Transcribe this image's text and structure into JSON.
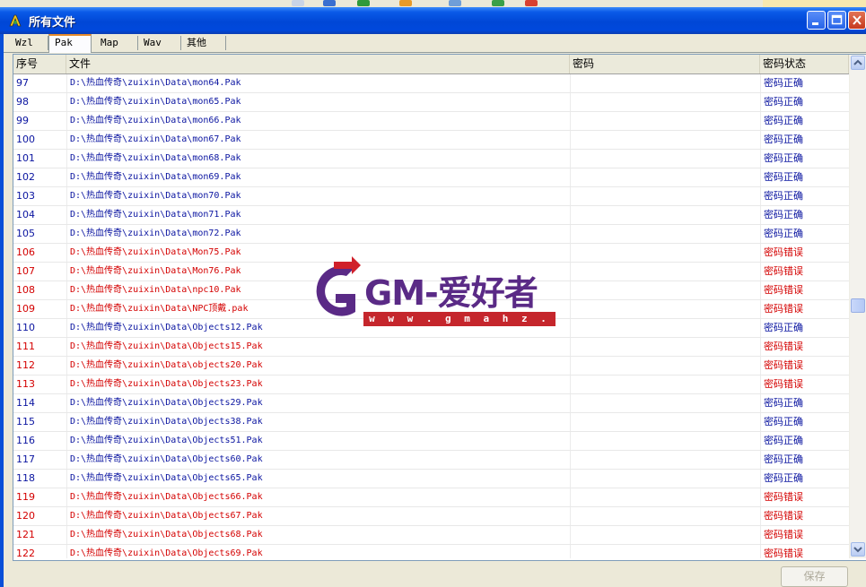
{
  "window": {
    "title": "所有文件"
  },
  "tabs": [
    {
      "label": "Wzl",
      "active": false
    },
    {
      "label": "Pak",
      "active": true
    },
    {
      "label": "Map",
      "active": false
    },
    {
      "label": "Wav",
      "active": false
    },
    {
      "label": "其他",
      "active": false
    }
  ],
  "columns": {
    "num": "序号",
    "file": "文件",
    "password": "密码",
    "status": "密码状态"
  },
  "rows": [
    {
      "num": "97",
      "file": "D:\\热血传奇\\zuixin\\Data\\mon64.Pak",
      "password": "",
      "status": "密码正确",
      "ok": true
    },
    {
      "num": "98",
      "file": "D:\\热血传奇\\zuixin\\Data\\mon65.Pak",
      "password": "",
      "status": "密码正确",
      "ok": true
    },
    {
      "num": "99",
      "file": "D:\\热血传奇\\zuixin\\Data\\mon66.Pak",
      "password": "",
      "status": "密码正确",
      "ok": true
    },
    {
      "num": "100",
      "file": "D:\\热血传奇\\zuixin\\Data\\mon67.Pak",
      "password": "",
      "status": "密码正确",
      "ok": true
    },
    {
      "num": "101",
      "file": "D:\\热血传奇\\zuixin\\Data\\mon68.Pak",
      "password": "",
      "status": "密码正确",
      "ok": true
    },
    {
      "num": "102",
      "file": "D:\\热血传奇\\zuixin\\Data\\mon69.Pak",
      "password": "",
      "status": "密码正确",
      "ok": true
    },
    {
      "num": "103",
      "file": "D:\\热血传奇\\zuixin\\Data\\mon70.Pak",
      "password": "",
      "status": "密码正确",
      "ok": true
    },
    {
      "num": "104",
      "file": "D:\\热血传奇\\zuixin\\Data\\mon71.Pak",
      "password": "",
      "status": "密码正确",
      "ok": true
    },
    {
      "num": "105",
      "file": "D:\\热血传奇\\zuixin\\Data\\mon72.Pak",
      "password": "",
      "status": "密码正确",
      "ok": true
    },
    {
      "num": "106",
      "file": "D:\\热血传奇\\zuixin\\Data\\Mon75.Pak",
      "password": "",
      "status": "密码错误",
      "ok": false
    },
    {
      "num": "107",
      "file": "D:\\热血传奇\\zuixin\\Data\\Mon76.Pak",
      "password": "",
      "status": "密码错误",
      "ok": false
    },
    {
      "num": "108",
      "file": "D:\\热血传奇\\zuixin\\Data\\npc10.Pak",
      "password": "",
      "status": "密码错误",
      "ok": false
    },
    {
      "num": "109",
      "file": "D:\\热血传奇\\zuixin\\Data\\NPC顶戴.pak",
      "password": "",
      "status": "密码错误",
      "ok": false
    },
    {
      "num": "110",
      "file": "D:\\热血传奇\\zuixin\\Data\\Objects12.Pak",
      "password": "",
      "status": "密码正确",
      "ok": true
    },
    {
      "num": "111",
      "file": "D:\\热血传奇\\zuixin\\Data\\Objects15.Pak",
      "password": "",
      "status": "密码错误",
      "ok": false
    },
    {
      "num": "112",
      "file": "D:\\热血传奇\\zuixin\\Data\\objects20.Pak",
      "password": "",
      "status": "密码错误",
      "ok": false
    },
    {
      "num": "113",
      "file": "D:\\热血传奇\\zuixin\\Data\\Objects23.Pak",
      "password": "",
      "status": "密码错误",
      "ok": false
    },
    {
      "num": "114",
      "file": "D:\\热血传奇\\zuixin\\Data\\Objects29.Pak",
      "password": "",
      "status": "密码正确",
      "ok": true
    },
    {
      "num": "115",
      "file": "D:\\热血传奇\\zuixin\\Data\\Objects38.Pak",
      "password": "",
      "status": "密码正确",
      "ok": true
    },
    {
      "num": "116",
      "file": "D:\\热血传奇\\zuixin\\Data\\Objects51.Pak",
      "password": "",
      "status": "密码正确",
      "ok": true
    },
    {
      "num": "117",
      "file": "D:\\热血传奇\\zuixin\\Data\\Objects60.Pak",
      "password": "",
      "status": "密码正确",
      "ok": true
    },
    {
      "num": "118",
      "file": "D:\\热血传奇\\zuixin\\Data\\Objects65.Pak",
      "password": "",
      "status": "密码正确",
      "ok": true
    },
    {
      "num": "119",
      "file": "D:\\热血传奇\\zuixin\\Data\\Objects66.Pak",
      "password": "",
      "status": "密码错误",
      "ok": false
    },
    {
      "num": "120",
      "file": "D:\\热血传奇\\zuixin\\Data\\Objects67.Pak",
      "password": "",
      "status": "密码错误",
      "ok": false
    },
    {
      "num": "121",
      "file": "D:\\热血传奇\\zuixin\\Data\\Objects68.Pak",
      "password": "",
      "status": "密码错误",
      "ok": false
    },
    {
      "num": "122",
      "file": "D:\\热血传奇\\zuixin\\Data\\Objects69.Pak",
      "password": "",
      "status": "密码错误",
      "ok": false
    }
  ],
  "save_label": "保存",
  "watermark": {
    "brand": "GM-爱好者",
    "url": "w w w . g m a h z . c o m"
  },
  "colors": {
    "ok": "#0a14a0",
    "bad": "#d40000",
    "titlebar": "#0047d6"
  }
}
